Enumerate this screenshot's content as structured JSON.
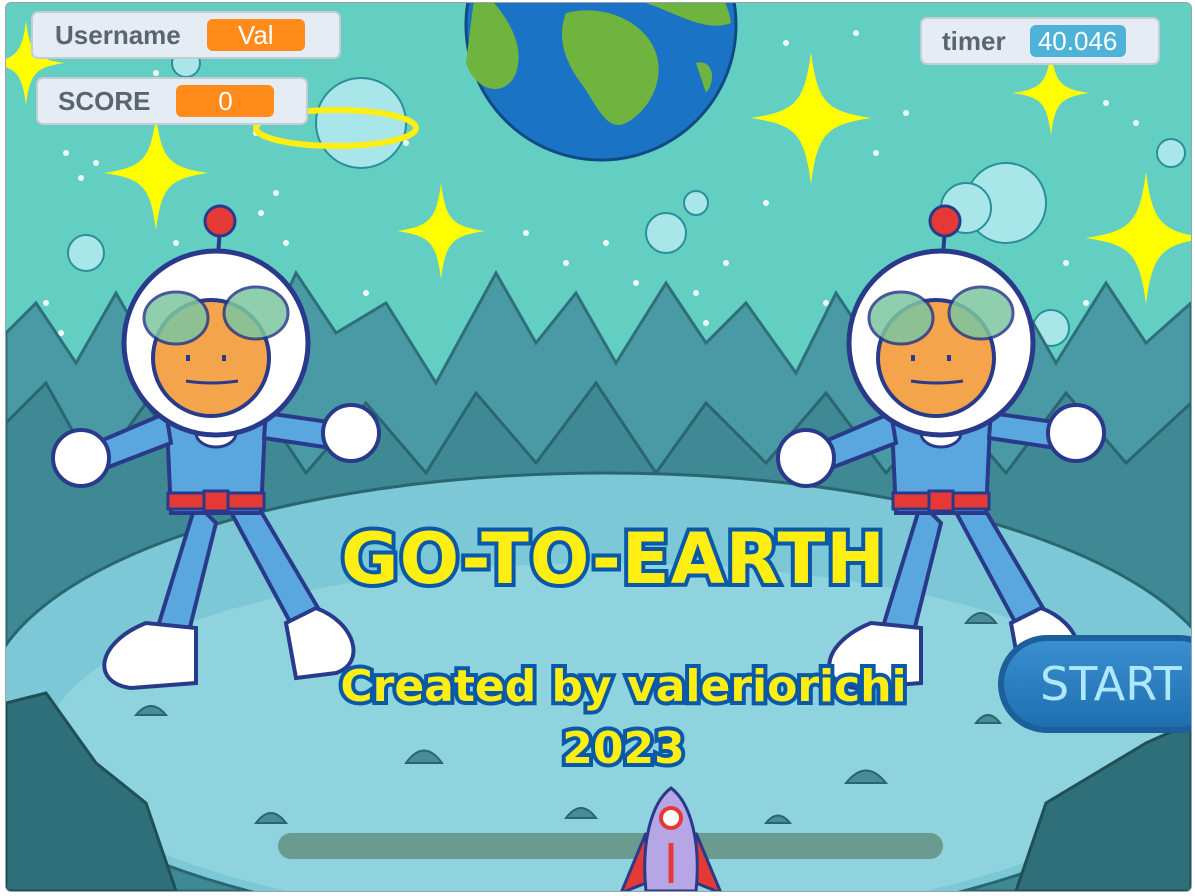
{
  "monitors": {
    "username": {
      "label": "Username",
      "value": "Val"
    },
    "score": {
      "label": "SCORE",
      "value": "0"
    },
    "timer": {
      "label": "timer",
      "value": "40.046"
    }
  },
  "title": "GO-TO-EARTH",
  "credit": "Created by valeriorichi",
  "year": "2023",
  "start_label": "START",
  "colors": {
    "sky": "#63cfc2",
    "title_fill": "#ffee11",
    "title_outline": "#0a58a8",
    "variable_orange": "#ff8c1a",
    "timer_blue": "#4fb3d9"
  }
}
